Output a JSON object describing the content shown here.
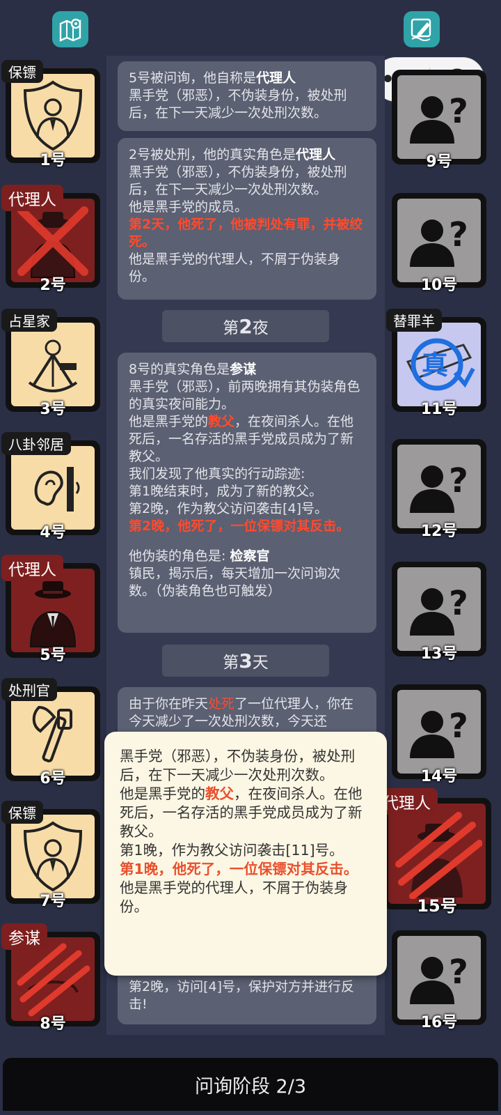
{
  "top": {
    "map_icon": "map-pin-icon",
    "notes_icon": "pen-note-icon"
  },
  "players": [
    {
      "num": "1号",
      "role": "保镖"
    },
    {
      "num": "2号",
      "role": "代理人"
    },
    {
      "num": "3号",
      "role": "占星家"
    },
    {
      "num": "4号",
      "role": "八卦邻居"
    },
    {
      "num": "5号",
      "role": "代理人"
    },
    {
      "num": "6号",
      "role": "处刑官"
    },
    {
      "num": "7号",
      "role": "保镖"
    },
    {
      "num": "8号",
      "role": "参谋"
    },
    {
      "num": "9号",
      "role": ""
    },
    {
      "num": "10号",
      "role": ""
    },
    {
      "num": "11号",
      "role": "替罪羊",
      "badge": "真"
    },
    {
      "num": "12号",
      "role": ""
    },
    {
      "num": "13号",
      "role": ""
    },
    {
      "num": "14号",
      "role": ""
    },
    {
      "num": "15号",
      "role": "代理人"
    },
    {
      "num": "16号",
      "role": ""
    }
  ],
  "feed": {
    "m1": {
      "l1a": "5号被问询，他自称是",
      "l1b": "代理人",
      "l2": "黑手党（邪恶），不伪装身份，被处刑后，在下一天减少一次处刑次数。"
    },
    "m2": {
      "l1a": "2号被处刑，他的真实角色是",
      "l1b": "代理人",
      "l2": "黑手党（邪恶），不伪装身份，被处刑后，在下一天减少一次处刑次数。",
      "l3": "他是黑手党的成员。",
      "l4": "第2天，他死了，他被判处有罪，并被绞死。",
      "l5": "他是黑手党的代理人，不屑于伪装身份。"
    },
    "phase1": {
      "pre": "第",
      "num": "2",
      "post": "夜"
    },
    "m3": {
      "l1a": "8号的真实角色是",
      "l1b": "参谋",
      "l2": "黑手党（邪恶），前两晚拥有其伪装角色的真实夜间能力。",
      "l3a": "他是黑手党的",
      "l3b": "教父",
      "l3c": "，在夜间杀人。在他死后，一名存活的黑手党成员成为了新教父。",
      "l4": "我们发现了他真实的行动踪迹:",
      "l5": "第1晚结束时，成为了新的教父。",
      "l6": "第2晚，作为教父访问袭击[4]号。",
      "l7": "第2晚，他死了，一位保镖对其反击。",
      "l8a": "他伪装的角色是: ",
      "l8b": "检察官",
      "l9": "镇民，揭示后，每天增加一次问询次数。（伪装角色也可触发）"
    },
    "phase2": {
      "pre": "第",
      "num": "3",
      "post": "天"
    },
    "m4": {
      "l1a": "由于你在昨天",
      "l1b": "处死",
      "l1c": "了一位代理人，你在今天减少了一次处刑次数，今天还"
    },
    "m5": {
      "l1": "第2晚，访问[4]号，保护对方并进行反击!"
    }
  },
  "popup": {
    "p1": "黑手党（邪恶），不伪装身份，被处刑后，在下一天减少一次处刑次数。",
    "p2a": "他是黑手党的",
    "p2b": "教父",
    "p2c": "，在夜间杀人。在他死后，一名存活的黑手党成员成为了新教父。",
    "p3": "第1晚，作为教父访问袭击[11]号。",
    "p4": "第1晚，他死了，一位保镖对其反击。",
    "p5": "他是黑手党的代理人，不屑于伪装身份。"
  },
  "bottom": {
    "label": "问询阶段 2/3"
  },
  "colors": {
    "background": "#2a2f45",
    "beige_card": "#f8dca8",
    "red_card": "#7e2020",
    "warn_text": "#ff4a2d",
    "teal_icon": "#2fa3a8"
  }
}
